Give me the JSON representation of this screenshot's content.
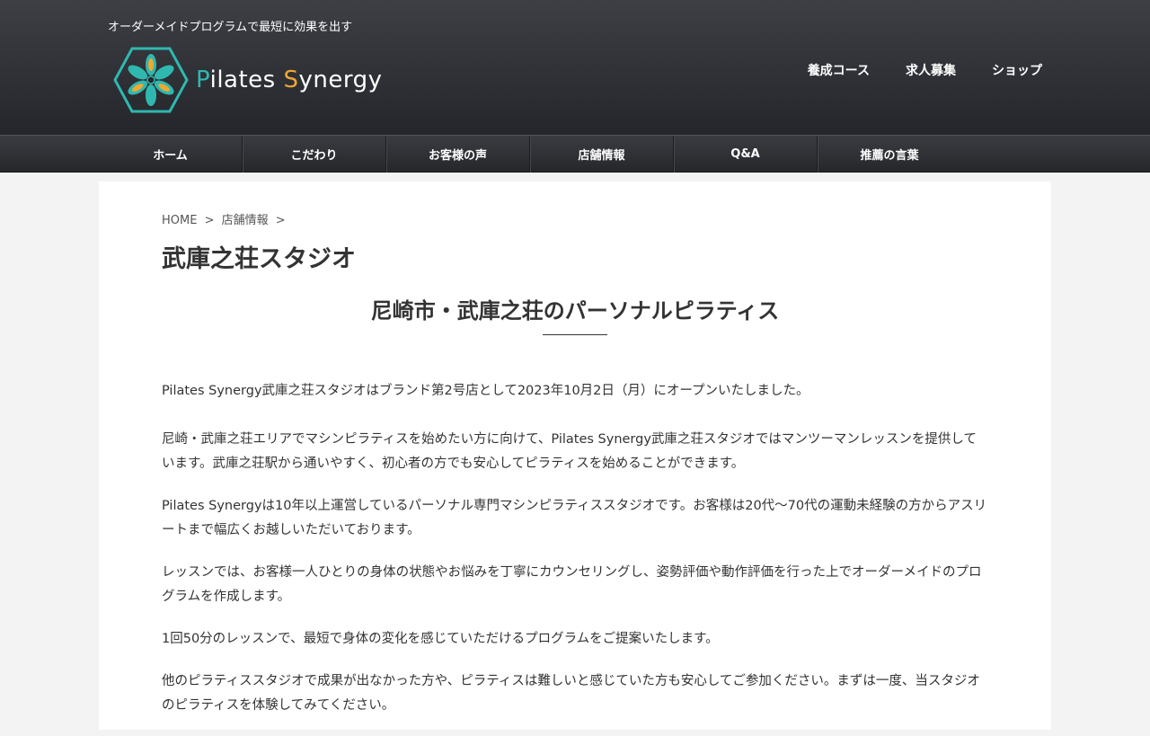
{
  "header": {
    "tagline": "オーダーメイドプログラムで最短に効果を出す",
    "logo_text_first": "P",
    "logo_text_mid": "ilates ",
    "logo_text_s": "S",
    "logo_text_end": "ynergy",
    "top_nav": [
      {
        "label": "養成コース"
      },
      {
        "label": "求人募集"
      },
      {
        "label": "ショップ"
      }
    ]
  },
  "main_nav": [
    {
      "label": "ホーム"
    },
    {
      "label": "こだわり"
    },
    {
      "label": "お客様の声"
    },
    {
      "label": "店舗情報"
    },
    {
      "label": "Q&A"
    },
    {
      "label": "推薦の言葉"
    }
  ],
  "breadcrumb": {
    "home": "HOME",
    "sep": ">",
    "current": "店舗情報"
  },
  "page_title": "武庫之荘スタジオ",
  "section_title": "尼崎市・武庫之荘のパーソナルピラティス",
  "paragraphs": [
    "Pilates Synergy武庫之荘スタジオはブランド第2号店として2023年10月2日（月）にオープンいたしました。",
    "尼崎・武庫之荘エリアでマシンピラティスを始めたい方に向けて、Pilates Synergy武庫之荘スタジオではマンツーマンレッスンを提供しています。武庫之荘駅から通いやすく、初心者の方でも安心してピラティスを始めることができます。",
    "Pilates Synergyは10年以上運営しているパーソナル専門マシンピラティススタジオです。お客様は20代〜70代の運動未経験の方からアスリートまで幅広くお越しいただいております。",
    "レッスンでは、お客様一人ひとりの身体の状態やお悩みを丁寧にカウンセリングし、姿勢評価や動作評価を行った上でオーダーメイドのプログラムを作成します。",
    "1回50分のレッスンで、最短で身体の変化を感じていただけるプログラムをご提案いたします。",
    "他のピラティススタジオで成果が出なかった方や、ピラティスは難しいと感じていた方も安心してご参加ください。まずは一度、当スタジオのピラティスを体験してみてください。"
  ],
  "colors": {
    "logo_teal": "#2fb8b0",
    "logo_orange": "#f0a830",
    "header_dark": "#24262b"
  }
}
